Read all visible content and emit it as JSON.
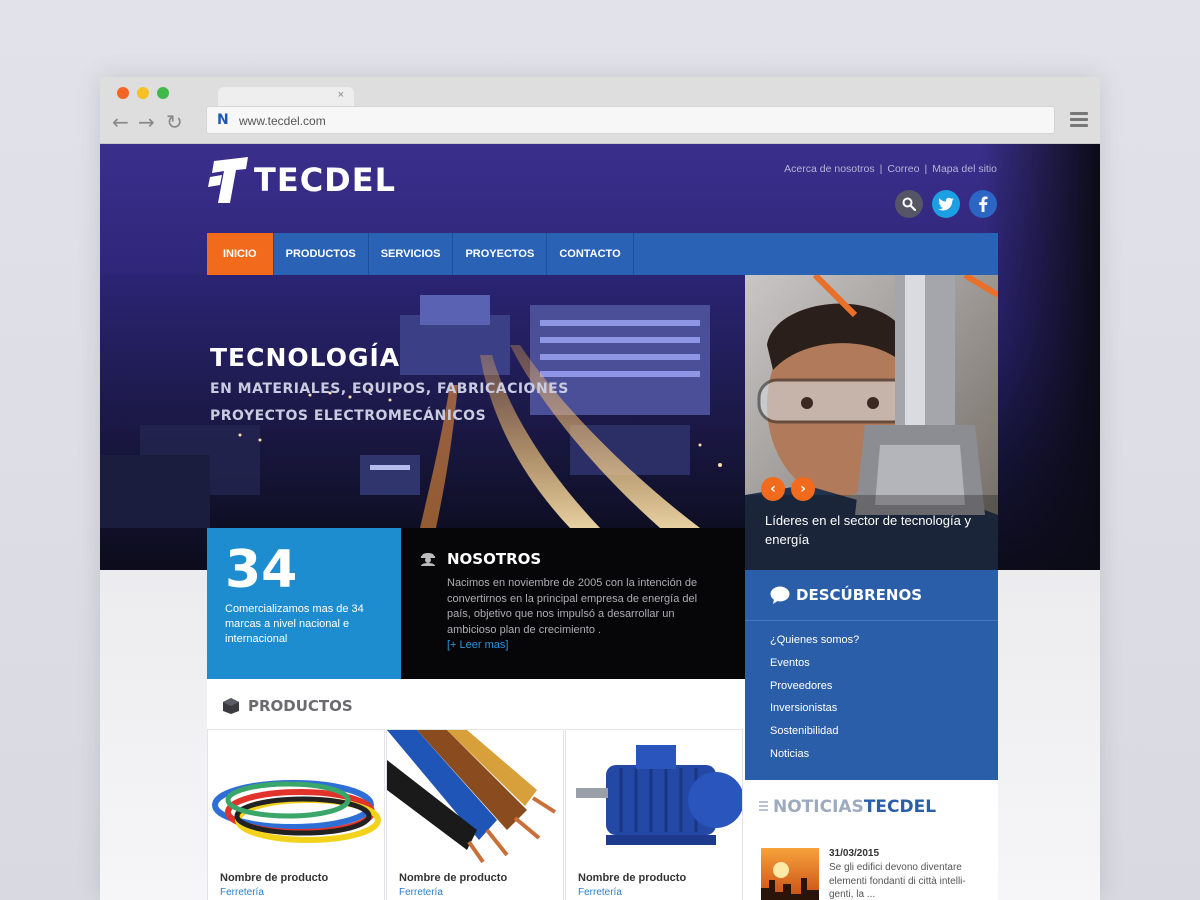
{
  "browser": {
    "tab_close": "×",
    "url": "www.tecdel.com",
    "url_logo": "N"
  },
  "site": {
    "logo_text": "TECDEL",
    "top_links": [
      "Acerca de nosotros",
      "Correo",
      "Mapa del sitio"
    ],
    "top_link_separator": "|",
    "social_icons": [
      "search-icon",
      "twitter-icon",
      "facebook-icon"
    ],
    "nav": [
      {
        "label": "INICIO",
        "active": true
      },
      {
        "label": "PRODUCTOS",
        "active": false
      },
      {
        "label": "SERVICIOS",
        "active": false
      },
      {
        "label": "PROYECTOS",
        "active": false
      },
      {
        "label": "CONTACTO",
        "active": false
      }
    ],
    "hero": {
      "title": "TECNOLOGÍA",
      "line1": "EN MATERIALES, EQUIPOS, FABRICACIONES",
      "line2": "PROYECTOS ELECTROMECÁNICOS"
    },
    "side_slide": {
      "caption": "Líderes en el sector de tecnología y energía",
      "prev": "‹",
      "next": "›"
    },
    "stat": {
      "number": "34",
      "text": "Comercializamos mas de 34 marcas a nivel nacional e internacional"
    },
    "about": {
      "title": "NOSOTROS",
      "text": "Nacimos en noviembre de 2005 con la intención de convertirnos en la principal empresa de energía del país, objetivo que nos impulsó a desarrollar un ambicioso plan de crecimiento .",
      "link": "[+ Leer mas]"
    },
    "discover": {
      "title": "DESCÚBRENOS",
      "items": [
        "¿Quienes somos?",
        "Eventos",
        "Proveedores",
        "Inversionistas",
        "Sostenibilidad",
        "Noticias"
      ]
    },
    "news": {
      "title_part1": "NOTICIAS",
      "title_part2": "TECDEL",
      "date": "31/03/2015",
      "text": "Se gli edifici devono diventare elementi fondanti di città intelli- genti, la ..."
    },
    "products": {
      "title": "PRODUCTOS",
      "items": [
        {
          "name": "Nombre de producto",
          "category": "Ferretería"
        },
        {
          "name": "Nombre de producto",
          "category": "Ferretería"
        },
        {
          "name": "Nombre de producto",
          "category": "Ferretería"
        }
      ]
    }
  },
  "colors": {
    "accent_orange": "#f26b1d",
    "nav_blue": "#2a63b6",
    "stat_blue": "#1e8dd0",
    "discover_blue": "#2b5ea8"
  }
}
